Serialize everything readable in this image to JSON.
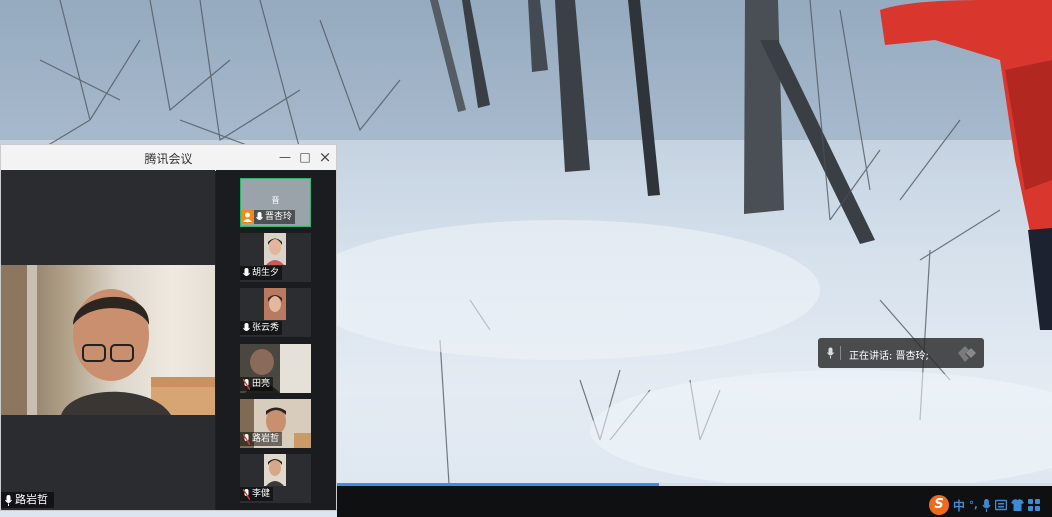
{
  "window": {
    "title": "腾讯会议",
    "minimize_icon": "—",
    "maximize_icon": "□",
    "close_icon": "×"
  },
  "main_video": {
    "speaker_name": "路岩哲"
  },
  "participants": [
    {
      "name": "晋杏玲",
      "center_text": "晋",
      "active": true
    },
    {
      "name": "胡生夕"
    },
    {
      "name": "张云秀"
    },
    {
      "name": "田亮"
    },
    {
      "name": "路岩哲"
    },
    {
      "name": "李健"
    }
  ],
  "speaking_indicator": {
    "label": "正在讲话: 晋杏玲;"
  },
  "playback": {
    "progress": 0.45
  },
  "ime_toolbar": {
    "logo": "S",
    "mode": "中",
    "punct": "°,"
  },
  "colors": {
    "accent_green": "#2fb36b",
    "progress_blue": "#3a8fe6",
    "ime_orange": "#f06a1d"
  }
}
